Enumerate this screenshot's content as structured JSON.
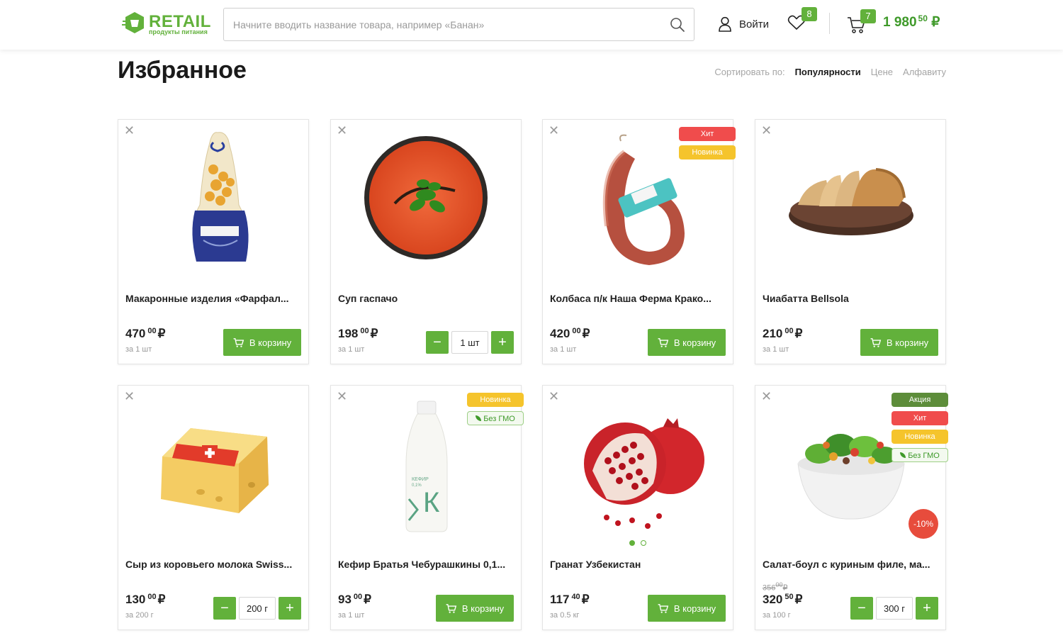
{
  "header": {
    "logo_title": "RETAIL",
    "logo_subtitle": "продукты питания",
    "search_placeholder": "Начните вводить название товара, например «Банан»",
    "login_label": "Войти",
    "favorites_count": "8",
    "cart_count": "7",
    "cart_total_main": "1 980",
    "cart_total_cents": "50",
    "currency": "₽"
  },
  "page": {
    "title": "Избранное",
    "sort_label": "Сортировать по:",
    "sort_options": [
      "Популярности",
      "Цене",
      "Алфавиту"
    ],
    "sort_active": "Популярности"
  },
  "colors": {
    "accent": "#62b13b",
    "tag_hit": "#f04c4c",
    "tag_new": "#f5c42c",
    "tag_sale": "#5d8d3a",
    "discount": "#e74c3c"
  },
  "buttons": {
    "add_to_cart": "В корзину",
    "minus": "−",
    "plus": "+"
  },
  "products": [
    {
      "name": "Макаронные изделия «Фарфал...",
      "price": "470",
      "cents": "00",
      "unit": "за 1 шт",
      "action": "cart",
      "tags": [],
      "image": "pasta-bag"
    },
    {
      "name": "Суп гаспачо",
      "price": "198",
      "cents": "00",
      "unit": "за 1 шт",
      "action": "stepper",
      "qty": "1 шт",
      "tags": [],
      "image": "soup-bowl"
    },
    {
      "name": "Колбаса п/к Наша Ферма Крако...",
      "price": "420",
      "cents": "00",
      "unit": "за 1 шт",
      "action": "cart",
      "tags": [
        "Хит",
        "Новинка"
      ],
      "image": "sausage"
    },
    {
      "name": "Чиабатта Bellsola",
      "price": "210",
      "cents": "00",
      "unit": "за 1 шт",
      "action": "cart",
      "tags": [],
      "image": "ciabatta"
    },
    {
      "name": "Сыр из коровьего молока Swiss...",
      "price": "130",
      "cents": "00",
      "unit": "за 200 г",
      "action": "stepper",
      "qty": "200 г",
      "tags": [],
      "image": "cheese"
    },
    {
      "name": "Кефир Братья Чебурашкины 0,1...",
      "price": "93",
      "cents": "00",
      "unit": "за 1 шт",
      "action": "cart",
      "tags": [
        "Новинка",
        "Без ГМО"
      ],
      "image": "kefir-bottle",
      "bottle_text": "КЕФИР",
      "bottle_fat": "0,1%",
      "bottle_letter": "К"
    },
    {
      "name": "Гранат Узбекистан",
      "price": "117",
      "cents": "40",
      "unit": "за 0.5 кг",
      "action": "cart",
      "tags": [],
      "image": "pomegranate",
      "gallery_dots": 2
    },
    {
      "name": "Салат-боул с куриным филе, ма...",
      "price": "320",
      "cents": "50",
      "unit": "за 100 г",
      "old_price": "356",
      "old_cents": "00",
      "action": "stepper",
      "qty": "300 г",
      "tags": [
        "Акция",
        "Хит",
        "Новинка",
        "Без ГМО"
      ],
      "discount": "-10%",
      "image": "salad-bowl"
    }
  ]
}
